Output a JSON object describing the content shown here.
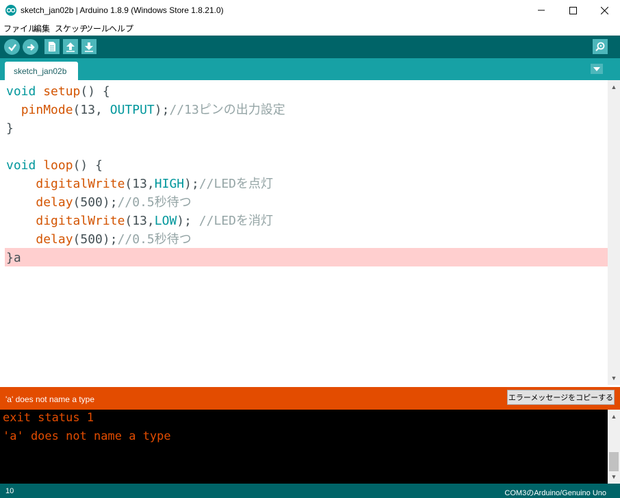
{
  "window": {
    "title": "sketch_jan02b | Arduino 1.8.9 (Windows Store 1.8.21.0)",
    "controls": [
      "minimize-icon",
      "maximize-icon",
      "close-icon"
    ]
  },
  "menu": [
    "ファイル",
    "編集",
    "スケッチ",
    "ツール",
    "ヘルプ"
  ],
  "toolbar": {
    "buttons": [
      "verify-icon",
      "upload-icon",
      "new-icon",
      "open-icon",
      "save-icon"
    ],
    "serial": "serial-monitor-icon"
  },
  "tab": {
    "label": "sketch_jan02b"
  },
  "code": {
    "lines": [
      [
        {
          "t": "void",
          "c": "kw"
        },
        {
          "t": " "
        },
        {
          "t": "setup",
          "c": "fn"
        },
        {
          "t": "() {"
        }
      ],
      [
        {
          "t": "  "
        },
        {
          "t": "pinMode",
          "c": "fn"
        },
        {
          "t": "(13, "
        },
        {
          "t": "OUTPUT",
          "c": "cn"
        },
        {
          "t": ");"
        },
        {
          "t": "//13ピンの出力設定",
          "c": "cm"
        }
      ],
      [
        {
          "t": "}"
        }
      ],
      [
        {
          "t": ""
        }
      ],
      [
        {
          "t": "void",
          "c": "kw"
        },
        {
          "t": " "
        },
        {
          "t": "loop",
          "c": "fn"
        },
        {
          "t": "() {"
        }
      ],
      [
        {
          "t": "    "
        },
        {
          "t": "digitalWrite",
          "c": "fn"
        },
        {
          "t": "(13,"
        },
        {
          "t": "HIGH",
          "c": "cn"
        },
        {
          "t": ");"
        },
        {
          "t": "//LEDを点灯",
          "c": "cm"
        }
      ],
      [
        {
          "t": "    "
        },
        {
          "t": "delay",
          "c": "fn"
        },
        {
          "t": "(500);"
        },
        {
          "t": "//0.5秒待つ",
          "c": "cm"
        }
      ],
      [
        {
          "t": "    "
        },
        {
          "t": "digitalWrite",
          "c": "fn"
        },
        {
          "t": "(13,"
        },
        {
          "t": "LOW",
          "c": "cn"
        },
        {
          "t": "); "
        },
        {
          "t": "//LEDを消灯",
          "c": "cm"
        }
      ],
      [
        {
          "t": "    "
        },
        {
          "t": "delay",
          "c": "fn"
        },
        {
          "t": "(500);"
        },
        {
          "t": "//0.5秒待つ",
          "c": "cm"
        }
      ],
      [
        {
          "t": "}a"
        }
      ]
    ],
    "error_line": 10
  },
  "status": {
    "message": "'a' does not name a type",
    "copy_button": "エラーメッセージをコピーする"
  },
  "console": {
    "lines": [
      "exit status 1",
      "'a' does not name a type"
    ]
  },
  "footer": {
    "line_number": "10",
    "board": "COM3のArduino/Genuino Uno"
  },
  "colors": {
    "toolbar": "#006468",
    "tabbar": "#17a1a5",
    "error_bar": "#e34c00",
    "error_highlight": "#ffcfcf",
    "keyword": "#00979c",
    "function": "#d35400",
    "comment": "#95a5a6"
  }
}
